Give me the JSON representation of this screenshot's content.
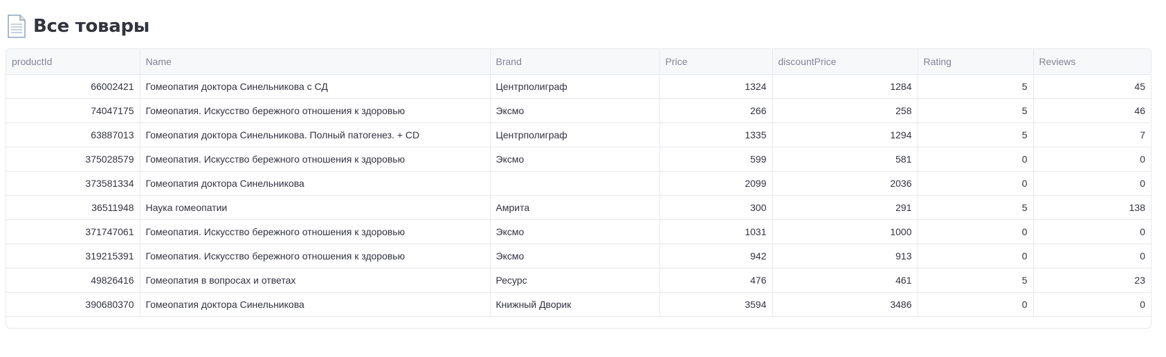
{
  "page": {
    "title": "Все товары",
    "title_icon": "document-icon"
  },
  "table": {
    "columns": [
      "productId",
      "Name",
      "Brand",
      "Price",
      "discountPrice",
      "Rating",
      "Reviews"
    ],
    "rows": [
      [
        "66002421",
        "Гомеопатия доктора Синельникова с СД",
        "Центрполиграф",
        "1324",
        "1284",
        "5",
        "45"
      ],
      [
        "74047175",
        "Гомеопатия. Искусство бережного отношения к здоровью",
        "Эксмо",
        "266",
        "258",
        "5",
        "46"
      ],
      [
        "63887013",
        "Гомеопатия доктора Синельникова. Полный патогенез. + CD",
        "Центрполиграф",
        "1335",
        "1294",
        "5",
        "7"
      ],
      [
        "375028579",
        "Гомеопатия. Искусство бережного отношения к здоровью",
        "Эксмо",
        "599",
        "581",
        "0",
        "0"
      ],
      [
        "373581334",
        "Гомеопатия доктора Синельникова",
        "",
        "2099",
        "2036",
        "0",
        "0"
      ],
      [
        "36511948",
        "Наука гомеопатии",
        "Амрита",
        "300",
        "291",
        "5",
        "138"
      ],
      [
        "371747061",
        "Гомеопатия. Искусство бережного отношения к здоровью",
        "Эксмо",
        "1031",
        "1000",
        "0",
        "0"
      ],
      [
        "319215391",
        "Гомеопатия. Искусство бережного отношения к здоровью",
        "Эксмо",
        "942",
        "913",
        "0",
        "0"
      ],
      [
        "49826416",
        "Гомеопатия в вопросах и ответах",
        "Ресурс",
        "476",
        "461",
        "5",
        "23"
      ],
      [
        "390680370",
        "Гомеопатия доктора Синельникова",
        "Книжный Дворик",
        "3594",
        "3486",
        "0",
        "0"
      ]
    ]
  }
}
